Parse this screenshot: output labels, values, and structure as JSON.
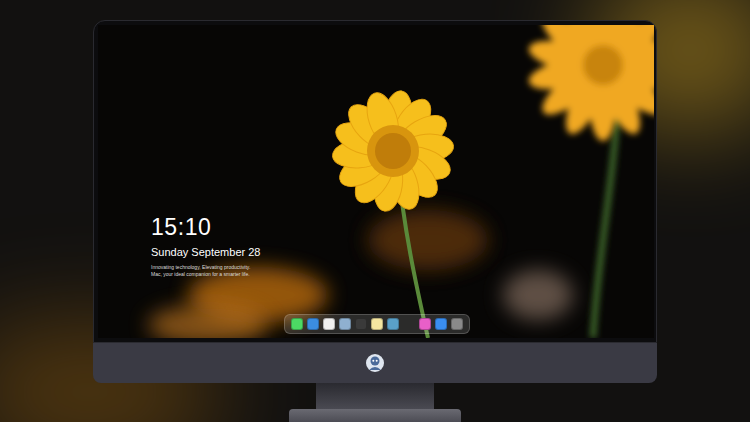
{
  "lock_screen": {
    "time": "15:10",
    "date": "Sunday September 28",
    "tagline": "Innovating technology, Elevating productivity. Mac, your ideal companion for a smarter life."
  },
  "dock": {
    "items": [
      {
        "color": "#4cd964"
      },
      {
        "color": "#3b8de0"
      },
      {
        "color": "#f0f0f0"
      },
      {
        "color": "#8fb0d0"
      },
      {
        "color": "#3a3a3a"
      },
      {
        "color": "#f5e6a0"
      },
      {
        "color": "#5aa0c8"
      },
      {
        "color": "#e85fc8"
      },
      {
        "color": "#3a8ef0"
      },
      {
        "color": "#8a8a8a"
      }
    ]
  }
}
